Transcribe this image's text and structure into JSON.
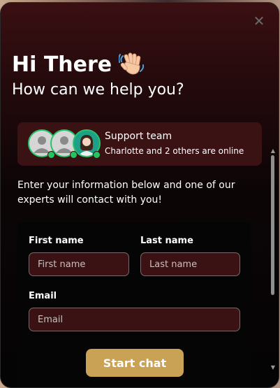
{
  "header": {
    "close_icon": "close-icon",
    "greeting": "Hi There",
    "greeting_emoji": "waving-hand-icon",
    "subtitle": "How can we help you?"
  },
  "support_card": {
    "title": "Support team",
    "status": "Charlotte and 2 others are online",
    "avatars": [
      "user-placeholder-icon",
      "user-placeholder-icon",
      "agent-avatar"
    ],
    "status_color": "#22c55e"
  },
  "intro_text": "Enter your information below and one of our experts will contact with you!",
  "form": {
    "first_name_label": "First name",
    "first_name_placeholder": "First name",
    "last_name_label": "Last name",
    "last_name_placeholder": "Last name",
    "email_label": "Email",
    "email_placeholder": "Email",
    "submit_label": "Start chat"
  },
  "colors": {
    "accent": "#c9a256",
    "card_background": "#3a1214",
    "online": "#22c55e"
  }
}
